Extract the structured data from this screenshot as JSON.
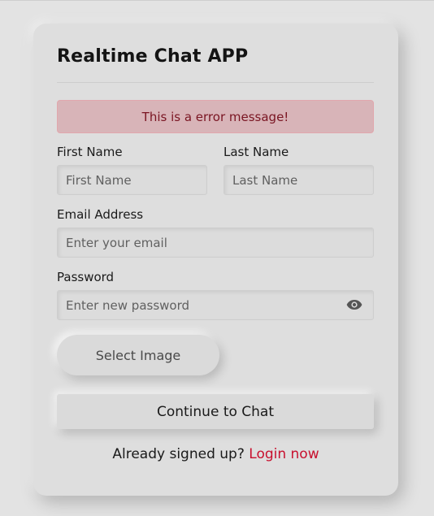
{
  "form": {
    "title": "Realtime Chat APP",
    "error_message": "This is a error message!",
    "first_name": {
      "label": "First Name",
      "placeholder": "First Name",
      "value": ""
    },
    "last_name": {
      "label": "Last Name",
      "placeholder": "Last Name",
      "value": ""
    },
    "email": {
      "label": "Email Address",
      "placeholder": "Enter your email",
      "value": ""
    },
    "password": {
      "label": "Password",
      "placeholder": "Enter new password",
      "value": "",
      "toggle_icon": "eye-icon"
    },
    "select_image_label": "Select Image",
    "submit_label": "Continue to Chat",
    "footer": {
      "prompt": "Already signed up?",
      "link_text": "Login now"
    }
  },
  "colors": {
    "page_background": "#e3e3e3",
    "card_background": "#dedede",
    "error_background": "#d8b4b8",
    "error_text": "#7a1522",
    "link": "#c8102e"
  }
}
